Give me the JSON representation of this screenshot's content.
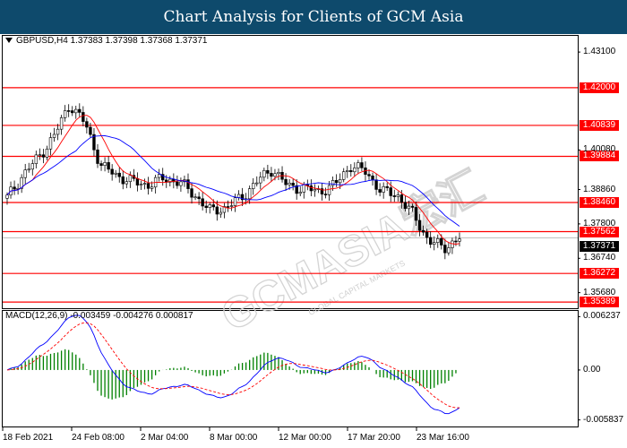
{
  "header": {
    "title": "Chart Analysis for Clients of GCM Asia"
  },
  "symbol_info": {
    "text": "GBPUSD,H4  1.37383 1.37398 1.37368 1.37371"
  },
  "macd_info": {
    "text": "MACD(12,26,9) -0.003459 -0.004276 0.000817"
  },
  "price_axis": [
    "1.43100",
    "1.40080",
    "1.38860",
    "1.37800",
    "1.36740",
    "1.35680"
  ],
  "levels": [
    "1.42000",
    "1.40839",
    "1.39884",
    "1.38460",
    "1.37562",
    "1.36272",
    "1.35389"
  ],
  "current_price": "1.37371",
  "macd_axis": [
    "0.006237",
    "0.00",
    "-0.005837"
  ],
  "time_axis": [
    "18 Feb 2021",
    "24 Feb 08:00",
    "2 Mar 04:00",
    "8 Mar 00:00",
    "12 Mar 00:00",
    "17 Mar 20:00",
    "23 Mar 16:00"
  ],
  "watermark": {
    "line1": "GCMASIA宏汇",
    "line2": "GLOBAL CAPITAL MARKETS"
  },
  "colors": {
    "header_bg": "#0e4a6c",
    "level_line": "#ff0000",
    "ma_red": "#ff0000",
    "ma_blue": "#0000ff",
    "candle": "#000000",
    "macd_hist": "#008000",
    "macd_signal": "#ff0000"
  },
  "chart_data": {
    "type": "candlestick",
    "symbol": "GBPUSD",
    "timeframe": "H4",
    "x": [
      "18 Feb 2021",
      "24 Feb 08:00",
      "2 Mar 04:00",
      "8 Mar 00:00",
      "12 Mar 00:00",
      "17 Mar 20:00",
      "23 Mar 16:00"
    ],
    "close": [
      1.386,
      1.393,
      1.3985,
      1.405,
      1.415,
      1.409,
      1.396,
      1.393,
      1.391,
      1.39,
      1.392,
      1.391,
      1.387,
      1.382,
      1.383,
      1.386,
      1.391,
      1.395,
      1.3895,
      1.389,
      1.388,
      1.39,
      1.396,
      1.394,
      1.388,
      1.387,
      1.381,
      1.373,
      1.3705,
      1.3737
    ],
    "support_resistance": [
      1.42,
      1.40839,
      1.39884,
      1.3846,
      1.37562,
      1.36272,
      1.35389
    ],
    "ylim": [
      1.352,
      1.436
    ],
    "macd": {
      "params": "12,26,9",
      "main": -0.003459,
      "signal": -0.004276,
      "histogram": 0.000817,
      "ylim": [
        -0.0065,
        0.0068
      ]
    }
  }
}
